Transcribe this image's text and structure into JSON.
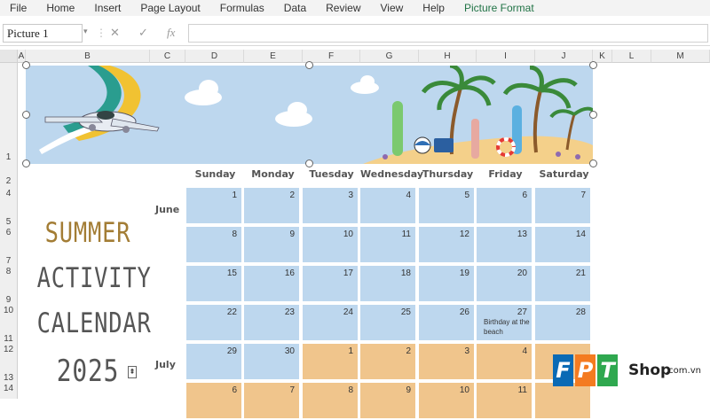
{
  "ribbon": {
    "tabs": [
      "File",
      "Home",
      "Insert",
      "Page Layout",
      "Formulas",
      "Data",
      "Review",
      "View",
      "Help",
      "Picture Format"
    ],
    "active_tab": "Picture Format"
  },
  "formula_bar": {
    "name_box": "Picture 1",
    "cancel_icon": "✕",
    "enter_icon": "✓",
    "fx_icon": "fx",
    "formula": ""
  },
  "columns": [
    "A",
    "B",
    "C",
    "D",
    "E",
    "F",
    "G",
    "H",
    "I",
    "J",
    "K",
    "L",
    "M"
  ],
  "rows": [
    "1",
    "2",
    "4",
    "5",
    "6",
    "7",
    "8",
    "9",
    "10",
    "11",
    "12",
    "13",
    "14"
  ],
  "calendar": {
    "title": [
      "SUMMER",
      "ACTIVITY",
      "CALENDAR",
      "2025"
    ],
    "days": [
      "Sunday",
      "Monday",
      "Tuesday",
      "Wednesday",
      "Thursday",
      "Friday",
      "Saturday"
    ],
    "months": [
      "June",
      "July"
    ],
    "weeks": [
      [
        "1",
        "2",
        "3",
        "4",
        "5",
        "6",
        "7"
      ],
      [
        "8",
        "9",
        "10",
        "11",
        "12",
        "13",
        "14"
      ],
      [
        "15",
        "16",
        "17",
        "18",
        "19",
        "20",
        "21"
      ],
      [
        "22",
        "23",
        "24",
        "25",
        "26",
        "27",
        "28"
      ],
      [
        "29",
        "30",
        "1",
        "2",
        "3",
        "4",
        ""
      ],
      [
        "6",
        "7",
        "8",
        "9",
        "10",
        "11",
        ""
      ]
    ],
    "note": "Birthday at the beach"
  },
  "watermark": {
    "letters": [
      "F",
      "P",
      "T"
    ],
    "brand": "Shop",
    "domain": ".com.vn"
  },
  "colors": {
    "june": "#bdd7ee",
    "july": "#f0c58c",
    "accent": "#217346",
    "title_gold": "#a37d35",
    "fpt_blue": "#0a6ab5",
    "fpt_orange": "#f47b20",
    "fpt_green": "#2fa84f"
  }
}
